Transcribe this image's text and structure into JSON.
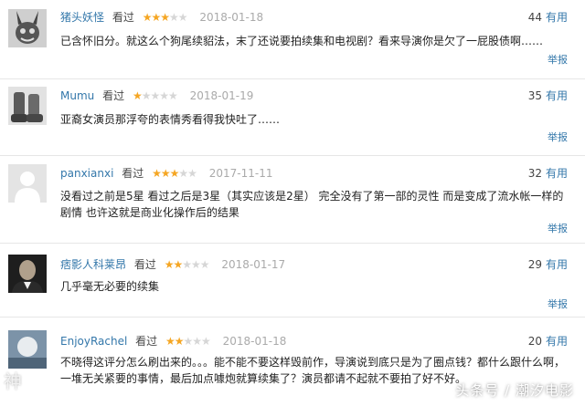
{
  "reviews": [
    {
      "user": "猪头妖怪",
      "saw_label": "看过",
      "rating": 3,
      "stars": [
        1,
        1,
        1,
        0,
        0
      ],
      "date": "2018-01-18",
      "votes": "44",
      "useful_label": "有用",
      "text": "已含怀旧分。就这么个狗尾续貂法，末了还说要拍续集和电视剧？看来导演你是欠了一屁股债啊……",
      "report_label": "举报",
      "avatar": "rabbit-avatar"
    },
    {
      "user": "Mumu",
      "saw_label": "看过",
      "rating": 1,
      "stars": [
        1,
        0,
        0,
        0,
        0
      ],
      "date": "2018-01-19",
      "votes": "35",
      "useful_label": "有用",
      "text": "亚裔女演员那浮夸的表情秀看得我快吐了……",
      "report_label": "举报",
      "avatar": "boots-avatar"
    },
    {
      "user": "panxianxi",
      "saw_label": "看过",
      "rating": 3,
      "stars": [
        1,
        1,
        1,
        0,
        0
      ],
      "date": "2017-11-11",
      "votes": "32",
      "useful_label": "有用",
      "text": "没看过之前是5星 看过之后是3星（其实应该是2星） 完全没有了第一部的灵性 而是变成了流水帐一样的剧情 也许这就是商业化操作后的结果",
      "report_label": "举报",
      "avatar": "default-avatar"
    },
    {
      "user": "痞影人科莱昂",
      "saw_label": "看过",
      "rating": 2,
      "stars": [
        1,
        1,
        0,
        0,
        0
      ],
      "date": "2018-01-17",
      "votes": "29",
      "useful_label": "有用",
      "text": "几乎毫无必要的续集",
      "report_label": "举报",
      "avatar": "portrait-avatar"
    },
    {
      "user": "EnjoyRachel",
      "saw_label": "看过",
      "rating": 2,
      "stars": [
        1,
        1,
        0,
        0,
        0
      ],
      "date": "2018-01-18",
      "votes": "20",
      "useful_label": "有用",
      "text": "不晓得这评分怎么刷出来的。。。能不能不要这样毁前作，导演说到底只是为了圈点钱？都什么跟什么啊，一堆无关紧要的事情，最后加点噱炮就算续集了？演员都请不起就不要拍了好不好。",
      "report_label": "举报",
      "avatar": "glow-avatar"
    }
  ],
  "watermark": "头条号 / 潮汐电影",
  "watermark_left": "神",
  "colors": {
    "link": "#3377aa",
    "star_on": "#f5a623",
    "star_off": "#d6d6d6",
    "date": "#aaaaaa",
    "separator": "#e6e6e6"
  }
}
